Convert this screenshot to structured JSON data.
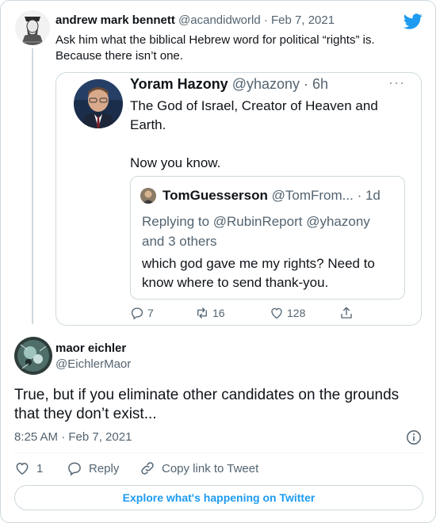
{
  "parent_tweet": {
    "author_name": "andrew mark bennett",
    "handle": "@acandidworld",
    "separator": " · ",
    "date": "Feb 7, 2021",
    "text": "Ask him what the biblical Hebrew word for political “rights” is. Because there isn’t one.",
    "avatar_icon": "engraved-portrait-avatar"
  },
  "brand": {
    "logo_icon": "twitter-bird-icon",
    "color": "#1d9bf0"
  },
  "quoted_tweet": {
    "author_name": "Yoram Hazony",
    "handle": "@yhazony",
    "separator": " · ",
    "time": "6h",
    "more_label": "···",
    "text": "The God of Israel, Creator of Heaven and Earth.\n\nNow you know.",
    "inner_quote": {
      "author_name": "TomGuesserson",
      "handle": "@TomFrom...",
      "separator": " · ",
      "time": "1d",
      "replying_to": "Replying to @RubinReport @yhazony and 3 others",
      "text": "which god gave me my rights?  Need to know where to send thank-you."
    },
    "actions": {
      "reply_count": "7",
      "retweet_count": "16",
      "like_count": "128"
    }
  },
  "main_tweet": {
    "author_name": "maor eichler",
    "handle": "@EichlerMaor",
    "text": "True, but if you eliminate other candidates on the grounds that they don’t exist...",
    "timestamp": "8:25 AM · Feb 7, 2021",
    "like_count": "1",
    "reply_label": "Reply",
    "copy_link_label": "Copy link to Tweet"
  },
  "explore_button": {
    "label": "Explore what's happening on Twitter"
  },
  "colors": {
    "accent": "#1d9bf0",
    "text_primary": "#0f1419",
    "text_secondary": "#536471",
    "border": "#cfd9de"
  }
}
